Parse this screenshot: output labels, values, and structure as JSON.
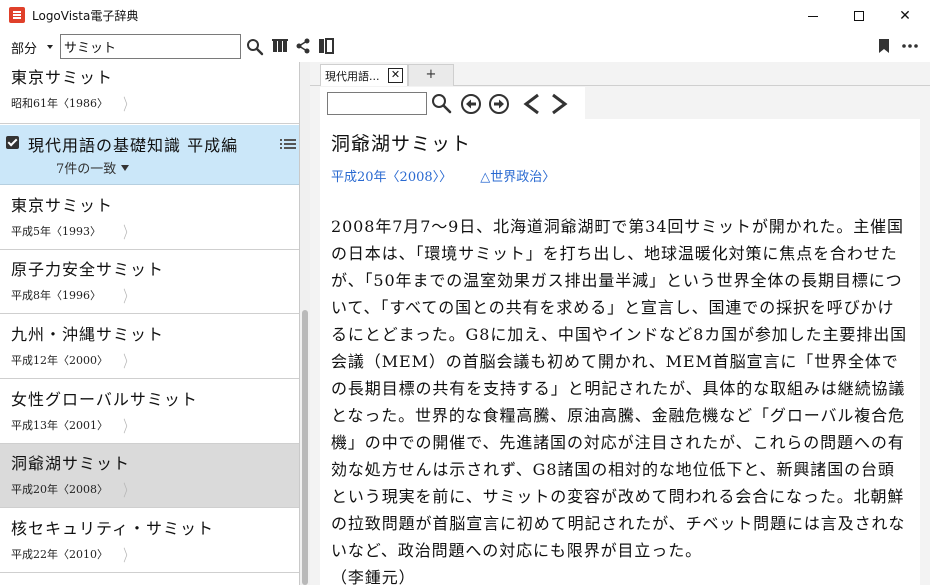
{
  "window": {
    "title": "LogoVista電子辞典",
    "minimize_icon": "minimize-icon",
    "maximize_icon": "maximize-icon",
    "close_symbol": "✕"
  },
  "toolbar": {
    "scope_label": "部分",
    "search_value": "サミット",
    "icons": [
      "search-icon",
      "books-icon",
      "share-icon",
      "panel-icon",
      "bookmark-icon",
      "more-icon"
    ]
  },
  "results": {
    "top_entry": {
      "title": "東京サミット",
      "date": "昭和61年〈1986〉"
    },
    "dictionary": {
      "name": "現代用語の基礎知識 平成編",
      "count": "7件の一致",
      "checked": true
    },
    "entries": [
      {
        "title": "東京サミット",
        "date": "平成5年〈1993〉"
      },
      {
        "title": "原子力安全サミット",
        "date": "平成8年〈1996〉"
      },
      {
        "title": "九州・沖縄サミット",
        "date": "平成12年〈2000〉"
      },
      {
        "title": "女性グローバルサミット",
        "date": "平成13年〈2001〉"
      },
      {
        "title": "洞爺湖サミット",
        "date": "平成20年〈2008〉",
        "selected": true
      },
      {
        "title": "核セキュリティ・サミット",
        "date": "平成22年〈2010〉"
      }
    ]
  },
  "tabs": {
    "active_label": "現代用語...",
    "add_label": "+"
  },
  "article": {
    "title": "洞爺湖サミット",
    "meta_date": "平成20年〈2008〉〉",
    "meta_category": "△世界政治〉",
    "body": "2008年7月7～9日、北海道洞爺湖町で第34回サミットが開かれた。主催国の日本は、「環境サミット」を打ち出し、地球温暖化対策に焦点を合わせたが、「50年までの温室効果ガス排出量半減」という世界全体の長期目標について、「すべての国との共有を求める」と宣言し、国連での採択を呼びかけるにとどまった。G8に加え、中国やインドなど8カ国が参加した主要排出国会議（MEM）の首脳会議も初めて開かれ、MEM首脳宣言に「世界全体での長期目標の共有を支持する」と明記されたが、具体的な取組みは継続協議となった。世界的な食糧高騰、原油高騰、金融危機など「グローバル複合危機」の中での開催で、先進諸国の対応が注目されたが、これらの問題への有効な処方せんは示されず、G8諸国の相対的な地位低下と、新興諸国の台頭という現実を前に、サミットの変容が改めて問われる会合になった。北朝鮮の拉致問題が首脳宣言に初めて明記されたが、チベット問題には言及されないなど、政治問題への対応にも限界が目立った。",
    "author": "（李鍾元）"
  },
  "colors": {
    "accent_icon": "#e0402a",
    "dictionary_header_bg": "#cbe7f9",
    "selected_entry_bg": "#dadada",
    "link_blue": "#2a6ad1"
  }
}
